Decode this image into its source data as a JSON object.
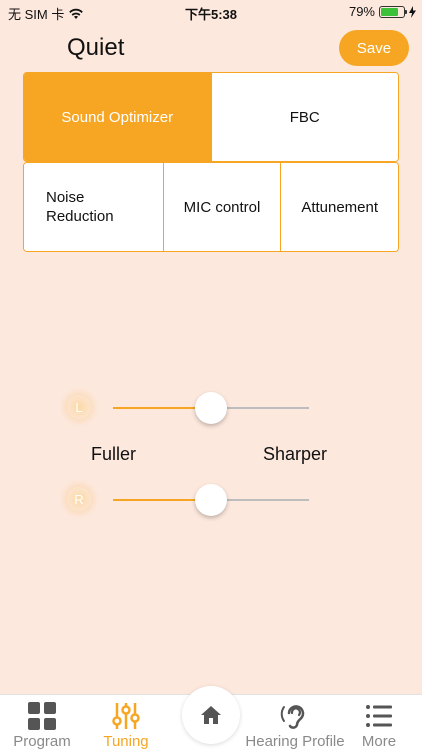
{
  "status_bar": {
    "carrier": "无 SIM 卡",
    "time": "下午5:38",
    "battery": "79%",
    "battery_level": 0.79
  },
  "header": {
    "title": "Quiet",
    "save_label": "Save"
  },
  "tabs": {
    "row1": [
      {
        "label": "Sound Optimizer",
        "active": true
      },
      {
        "label": "FBC",
        "active": false
      }
    ],
    "row2": [
      {
        "label": "Noise Reduction",
        "active": false
      },
      {
        "label": "MIC control",
        "active": false
      },
      {
        "label": "Attunement",
        "active": false
      }
    ]
  },
  "sliders": {
    "left": {
      "badge": "L",
      "value": 0.5
    },
    "right": {
      "badge": "R",
      "value": 0.5
    },
    "min_label": "Fuller",
    "max_label": "Sharper"
  },
  "tab_bar": {
    "items": [
      {
        "label": "Program",
        "icon": "grid-icon",
        "active": false
      },
      {
        "label": "Tuning",
        "icon": "sliders-icon",
        "active": true
      },
      {
        "label": "",
        "icon": "home-icon",
        "active": false
      },
      {
        "label": "Hearing Profile",
        "icon": "ear-icon",
        "active": false
      },
      {
        "label": "More",
        "icon": "list-icon",
        "active": false
      }
    ]
  },
  "colors": {
    "accent": "#f6a623",
    "background": "#fde8dd"
  }
}
